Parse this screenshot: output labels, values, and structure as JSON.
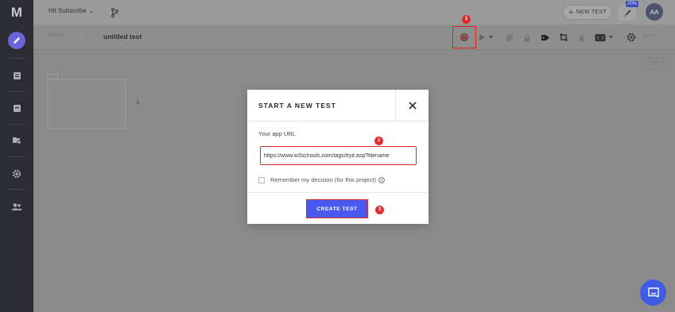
{
  "app": {
    "logo_letter": "M",
    "project_name": "Hit Subscribe",
    "new_test_label": "NEW TEST",
    "percent_badge": "20%",
    "avatar_initials": "AA"
  },
  "subbar": {
    "select_label": "Select",
    "test_name": "untitled test",
    "save_label": "Save"
  },
  "modal": {
    "title": "START A NEW TEST",
    "url_label": "Your app URL",
    "url_value": "https://www.w3schools.com/tags/tryit.asp?filename",
    "remember_label": "Remember my decision (for this project)",
    "create_label": "CREATE TEST"
  },
  "markers": {
    "m1": "1",
    "m2": "2",
    "m3": "3"
  },
  "colors": {
    "accent": "#4a5af0",
    "highlight": "#e02020",
    "sidebar": "#2b2d33",
    "active_nav": "#6a64d8",
    "chat": "#3f5ce4"
  },
  "icons": [
    "logo",
    "pencil-icon",
    "list-icon",
    "archive-icon",
    "tag-folder-icon",
    "gear-icon",
    "users-icon",
    "branch-icon",
    "rocket-icon",
    "record-icon",
    "play-icon",
    "copy-icon",
    "lock-icon",
    "tag-icon",
    "crop-icon",
    "trash-icon",
    "code-icon",
    "settings-icon",
    "close-icon",
    "info-icon",
    "chat-icon"
  ]
}
